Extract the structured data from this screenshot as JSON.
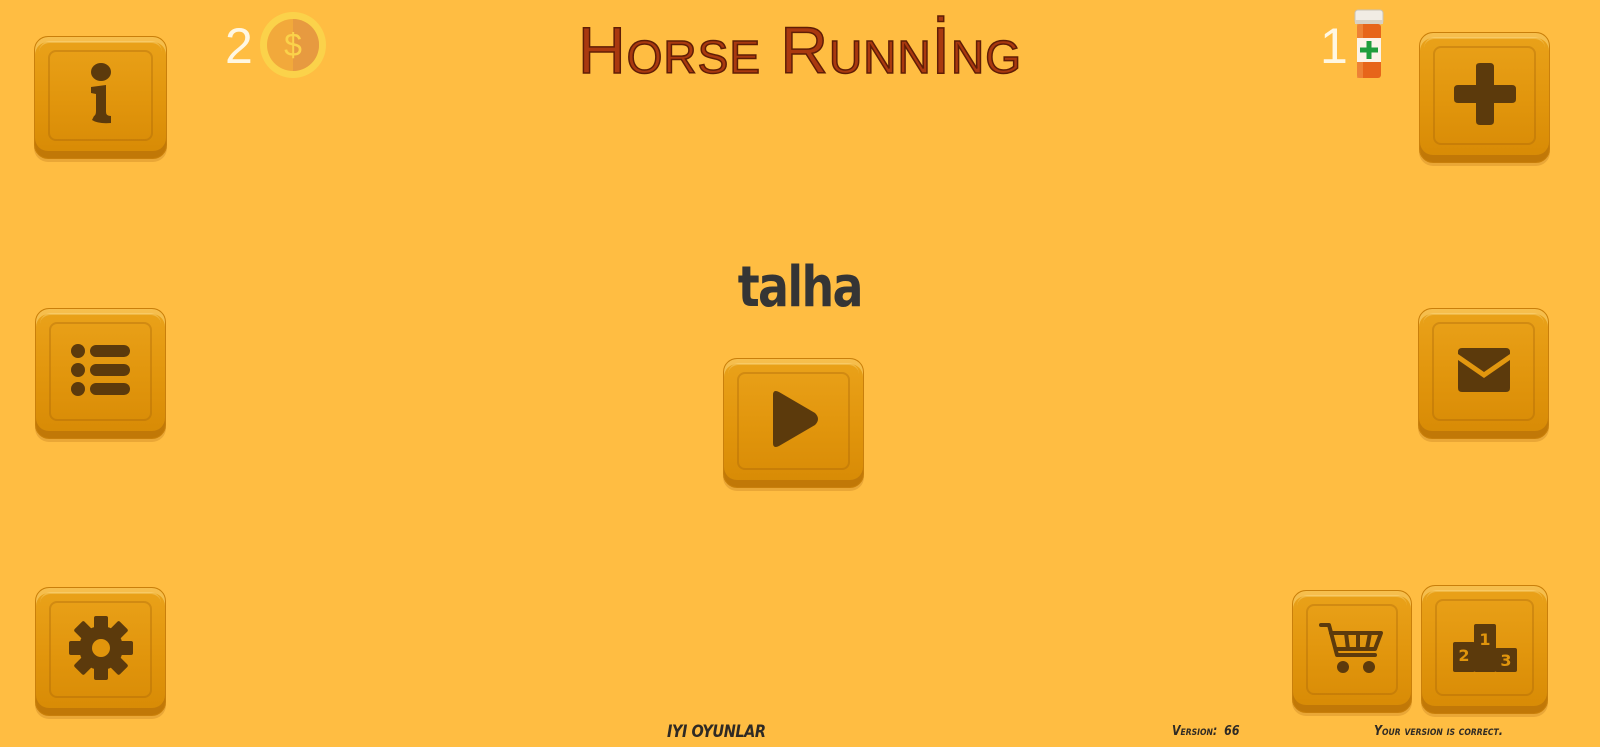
{
  "title": "Horse Runnİng",
  "player_name": "talha",
  "currency": {
    "coins": "2",
    "coin_symbol": "$",
    "health_items": "1"
  },
  "footer": {
    "studio": "IYI OYUNLAR",
    "version_label": "Version:",
    "version_number": "66",
    "version_status": "Your version is correct."
  },
  "buttons": {
    "info": "info-icon",
    "list": "list-icon",
    "settings": "gear-icon",
    "play": "play-icon",
    "add": "plus-icon",
    "mail": "envelope-icon",
    "shop": "cart-icon",
    "leaderboard": "podium-icon",
    "podium_digits": [
      "2",
      "1",
      "3"
    ]
  },
  "colors": {
    "background": "#ffbd42",
    "tile": "#e1950c",
    "icon": "#5c3a0c",
    "title": "#a9390f",
    "coin": "#f6c23c",
    "counter_text": "#fff7e2"
  }
}
